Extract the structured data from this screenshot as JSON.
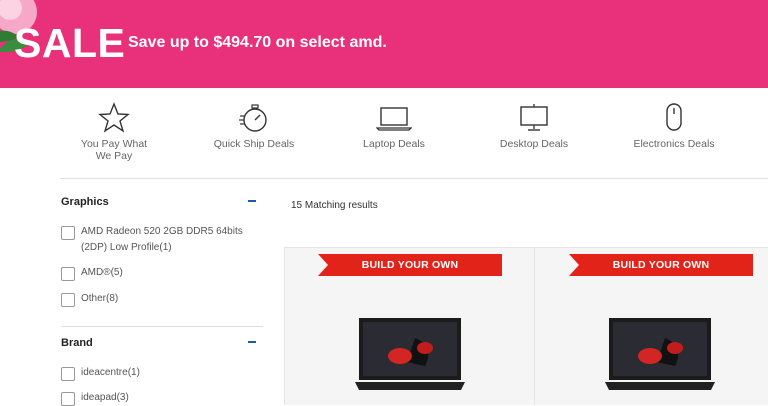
{
  "banner": {
    "sale": "SALE",
    "subtitle": "Save up to $494.70 on select amd."
  },
  "categories": [
    {
      "label": "You Pay What We Pay",
      "icon": "star-icon"
    },
    {
      "label": "Quick Ship Deals",
      "icon": "stopwatch-icon"
    },
    {
      "label": "Laptop Deals",
      "icon": "laptop-icon"
    },
    {
      "label": "Desktop Deals",
      "icon": "desktop-icon"
    },
    {
      "label": "Electronics Deals",
      "icon": "mouse-icon"
    }
  ],
  "filters": {
    "graphics": {
      "title": "Graphics",
      "options": [
        "AMD Radeon 520 2GB DDR5 64bits (2DP) Low Profile(1)",
        "AMD®(5)",
        "Other(8)"
      ]
    },
    "brand": {
      "title": "Brand",
      "options": [
        "ideacentre(1)",
        "ideapad(3)"
      ]
    }
  },
  "results": {
    "count_text": "15 Matching results",
    "cards": [
      {
        "ribbon": "BUILD YOUR OWN"
      },
      {
        "ribbon": "BUILD YOUR OWN"
      }
    ]
  },
  "colors": {
    "banner_pink": "#e8317a",
    "ribbon_red": "#e2231a",
    "collapse_blue": "#1a5da6"
  }
}
